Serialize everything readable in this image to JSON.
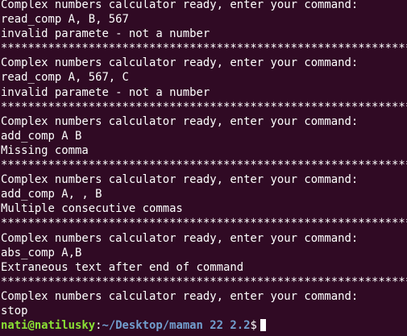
{
  "terminal": {
    "lines": [
      "Complex numbers calculator ready, enter your command:",
      "read_comp A, B, 567",
      "invalid paramete - not a number",
      "*************************************************************",
      "Complex numbers calculator ready, enter your command:",
      "read_comp A, 567, C",
      "invalid paramete - not a number",
      "*************************************************************",
      "Complex numbers calculator ready, enter your command:",
      "add_comp A B",
      "Missing comma",
      "*************************************************************",
      "Complex numbers calculator ready, enter your command:",
      "add_comp A, , B",
      "Multiple consecutive commas",
      "*************************************************************",
      "Complex numbers calculator ready, enter your command:",
      "abs_comp A,B",
      "Extraneous text after end of command",
      "*************************************************************",
      "Complex numbers calculator ready, enter your command:",
      "stop"
    ],
    "prompt": {
      "user_host": "nati@natilusky",
      "colon": ":",
      "path": "~/Desktop/maman 22 2.2",
      "dollar": "$"
    },
    "colors": {
      "background": "#300a24",
      "text": "#ffffff",
      "user_host": "#8ae234",
      "path": "#729fcf"
    }
  }
}
